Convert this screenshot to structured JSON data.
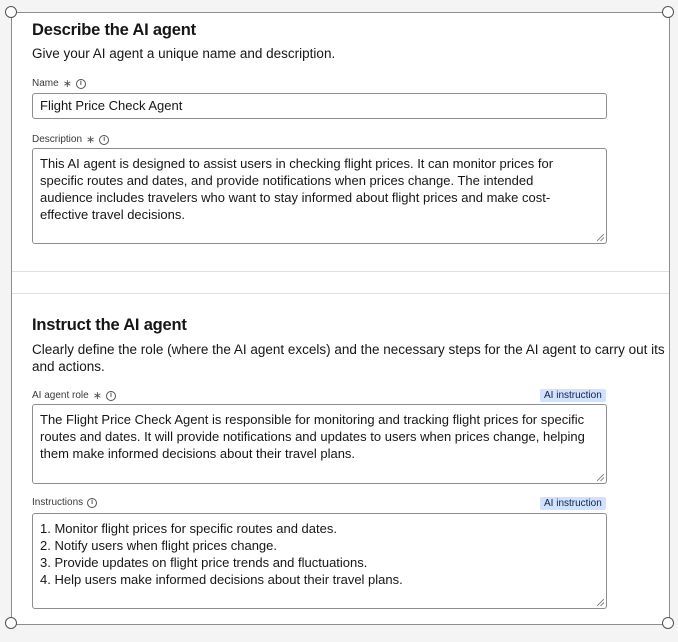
{
  "describe": {
    "title": "Describe the AI agent",
    "subtitle": "Give your AI agent a unique name and description.",
    "name": {
      "label": "Name",
      "value": "Flight Price Check Agent"
    },
    "description": {
      "label": "Description",
      "lines": [
        "This AI agent is designed to assist users in checking flight prices. It can monitor prices for",
        "specific routes and dates, and provide notifications when prices change. The intended",
        "audience includes travelers who want to stay informed about flight prices and make cost-",
        "effective travel decisions."
      ]
    }
  },
  "instruct": {
    "title": "Instruct the AI agent",
    "subtitle_lines": [
      "Clearly define the role (where the AI agent excels) and the necessary steps for the AI agent to carry out its r",
      "and actions."
    ],
    "role": {
      "label": "AI agent role",
      "tag": "AI instruction",
      "lines": [
        "The Flight Price Check Agent is responsible for monitoring and tracking flight prices for specific",
        "routes and dates. It will provide notifications and updates to users when prices change, helping",
        "them make informed decisions about their travel plans."
      ]
    },
    "instructions": {
      "label": "Instructions",
      "tag": "AI instruction",
      "lines": [
        "1. Monitor flight prices for specific routes and dates.",
        "2. Notify users when flight prices change.",
        "3. Provide updates on flight price trends and fluctuations.",
        "4. Help users make informed decisions about their travel plans."
      ]
    }
  },
  "icons": {
    "required": "asterisk-icon",
    "info": "info-icon"
  },
  "colors": {
    "tag_bg": "#d0e2ff",
    "border": "#8d8d8d"
  }
}
